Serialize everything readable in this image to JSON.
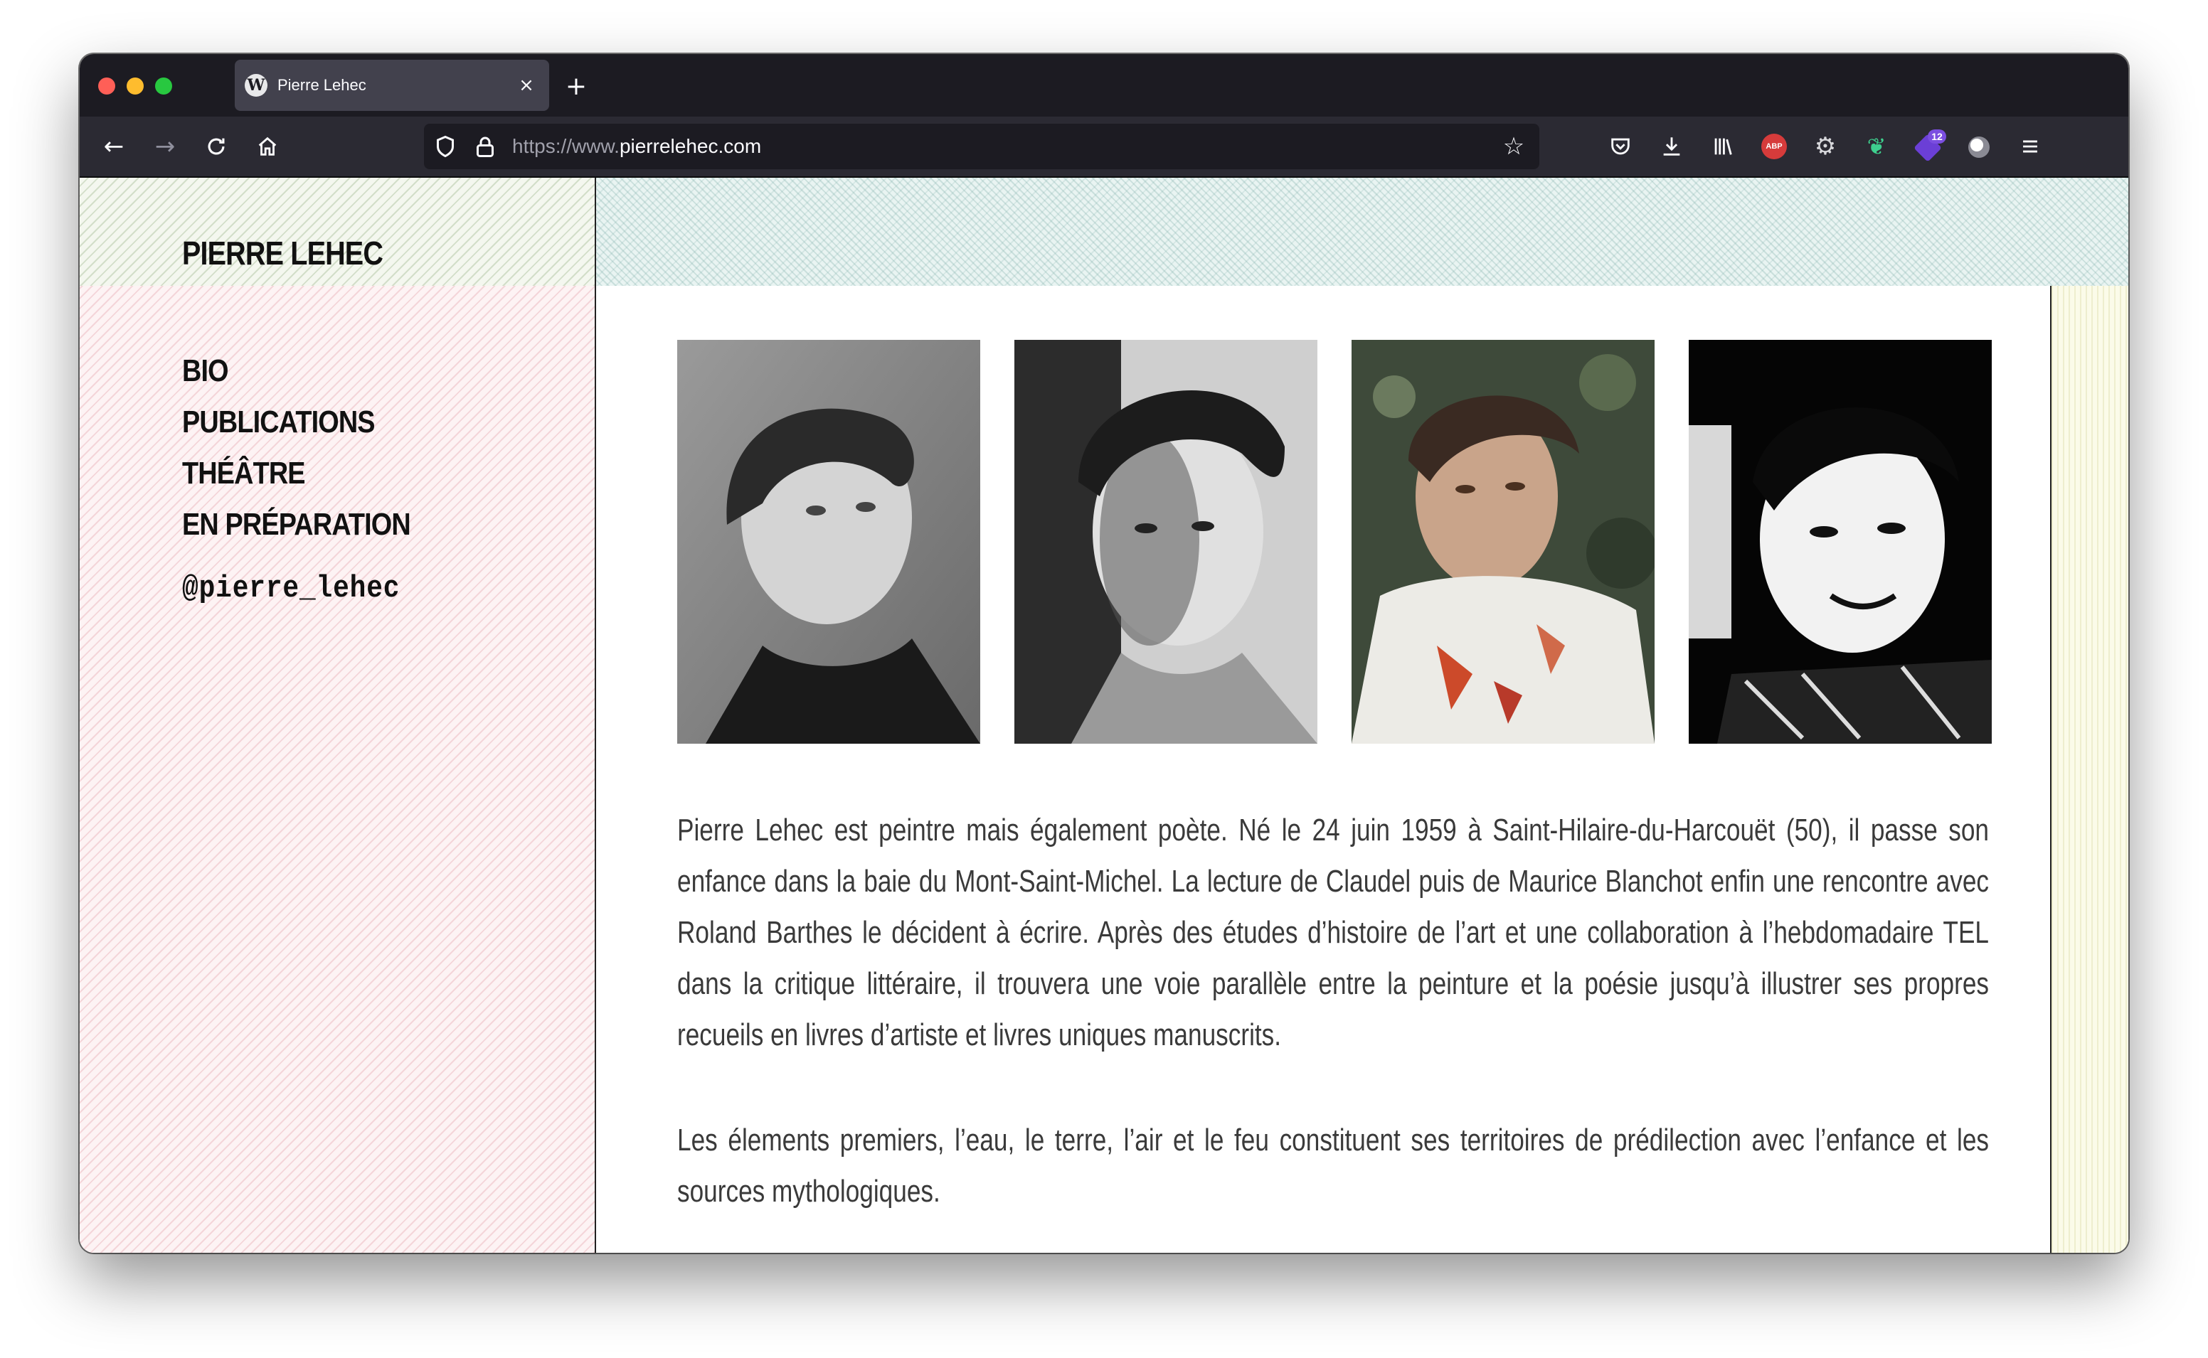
{
  "browser": {
    "tab": {
      "title": "Pierre Lehec"
    },
    "url": {
      "prefix": "https://www.",
      "domain": "pierrelehec.com"
    },
    "toolbar": {
      "extension_badge": "12",
      "abp_label": "ABP"
    }
  },
  "site": {
    "brand": "PIERRE LEHEC",
    "menu": [
      "BIO",
      "PUBLICATIONS",
      "THÉÂTRE",
      "EN PRÉPARATION"
    ],
    "social_handle": "@pierre_lehec"
  },
  "main": {
    "paragraphs": [
      "Pierre Lehec est peintre mais également poète. Né le 24 juin 1959 à Saint-Hilaire-du-Harcouët (50), il passe son enfance dans la baie du Mont-Saint-Michel. La lecture de Claudel puis de Maurice Blanchot enfin une rencontre avec Roland Barthes le décident à écrire. Après des études d’histoire de l’art et une collaboration à l’hebdomadaire TEL dans la critique littéraire, il trouvera une voie parallèle entre la peinture et la poésie jusqu’à illustrer ses propres recueils en livres d’artiste et livres uniques manuscrits.",
      "Les élements premiers, l’eau, le terre, l’air et le feu constituent ses territoires de prédilection avec l’enfance et les sources mythologiques."
    ]
  },
  "colors": {
    "tabstrip": "#1c1b22",
    "navbar": "#2b2a33",
    "header_pattern": "#e9f4f2",
    "sidebar_pattern": "#fdf3f4",
    "right_stripe": "#fbfbe9",
    "text": "#3a3a3a"
  }
}
